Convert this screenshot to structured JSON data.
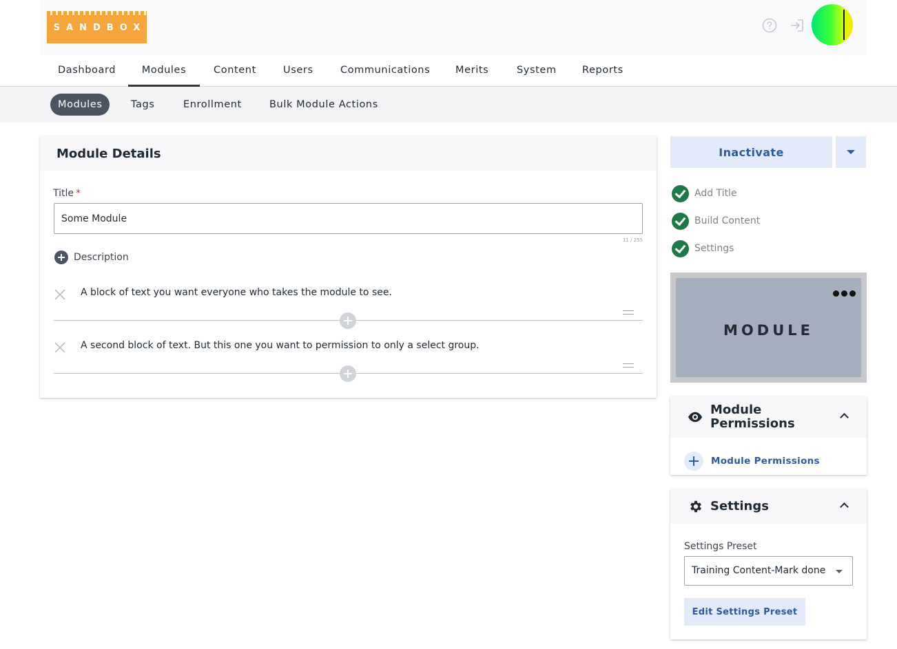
{
  "header": {
    "logo_text": "SANDBOX",
    "help_icon": "question-circle-icon",
    "logout_icon": "sign-out-icon"
  },
  "main_nav": {
    "tabs": [
      {
        "label": "Dashboard"
      },
      {
        "label": "Modules",
        "active": true
      },
      {
        "label": "Content"
      },
      {
        "label": "Users"
      },
      {
        "label": "Communications"
      },
      {
        "label": "Merits"
      },
      {
        "label": "System"
      },
      {
        "label": "Reports"
      }
    ]
  },
  "sub_nav": {
    "tabs": [
      {
        "label": "Modules",
        "active": true
      },
      {
        "label": "Tags"
      },
      {
        "label": "Enrollment"
      },
      {
        "label": "Bulk Module Actions"
      }
    ]
  },
  "module_details": {
    "heading": "Module Details",
    "title_label": "Title",
    "required_mark": "*",
    "title_value": "Some Module",
    "char_counter": "11 / 255",
    "description_label": "Description",
    "blocks": [
      {
        "text": "A block of text you want everyone who takes the module to see."
      },
      {
        "text": "A second block of text. But this one you want to permission to only a select group."
      }
    ]
  },
  "actions": {
    "inactivate_label": "Inactivate",
    "dropdown_icon": "caret-down-icon"
  },
  "steps": [
    {
      "label": "Add Title",
      "done": true
    },
    {
      "label": "Build Content",
      "done": true
    },
    {
      "label": "Settings",
      "done": true
    }
  ],
  "thumbnail": {
    "text": "MODULE",
    "menu_icon": "more-horizontal-icon"
  },
  "permissions_panel": {
    "title_line1": "Module",
    "title_line2": "Permissions",
    "icon": "eye-icon",
    "add_label": "Module Permissions"
  },
  "settings_panel": {
    "title": "Settings",
    "icon": "gear-icon",
    "preset_label": "Settings Preset",
    "preset_value": "Training Content-Mark done",
    "edit_button_label": "Edit Settings Preset"
  },
  "colors": {
    "accent": "#2c5aa0",
    "logo": "#f6a53a",
    "success": "#1d7a46"
  }
}
